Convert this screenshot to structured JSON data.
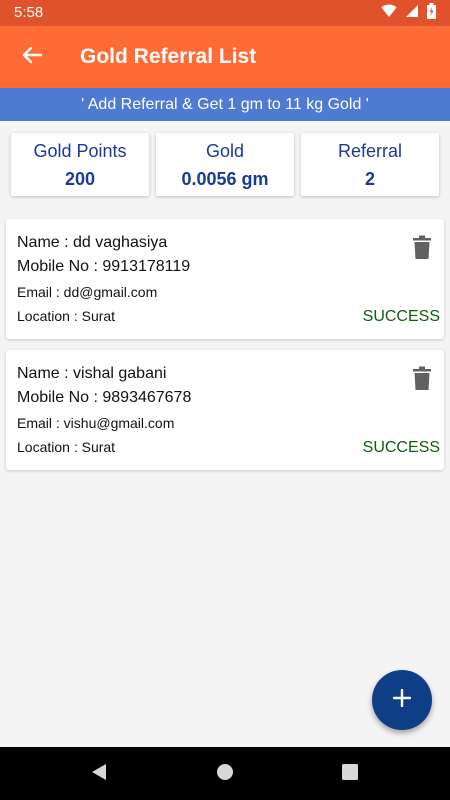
{
  "status_bar": {
    "time": "5:58"
  },
  "app_bar": {
    "title": "Gold Referral List"
  },
  "banner": {
    "text": "' Add Referral &  Get 1 gm to 11 kg Gold '"
  },
  "stats": [
    {
      "label": "Gold Points",
      "value": "200"
    },
    {
      "label": "Gold",
      "value": "0.0056 gm"
    },
    {
      "label": "Referral",
      "value": "2"
    }
  ],
  "referrals": [
    {
      "name": "Name : dd vaghasiya",
      "mobile": "Mobile No : 9913178119",
      "email": "Email : dd@gmail.com",
      "location": "Location : Surat",
      "status": "SUCCESS"
    },
    {
      "name": "Name : vishal gabani",
      "mobile": "Mobile No : 9893467678",
      "email": "Email : vishu@gmail.com",
      "location": "Location : Surat",
      "status": "SUCCESS"
    }
  ],
  "icons": {
    "back": "arrow-back-icon",
    "delete": "trash-icon",
    "add": "plus-icon",
    "wifi": "wifi-icon",
    "signal": "cell-signal-icon",
    "battery": "battery-icon"
  },
  "colors": {
    "app_bar": "#ff6b35",
    "status_bar": "#e0522b",
    "banner": "#4d7bd1",
    "stat_text": "#1a3a9a",
    "status_success": "#0f5c0f",
    "fab": "#0e3f86"
  }
}
